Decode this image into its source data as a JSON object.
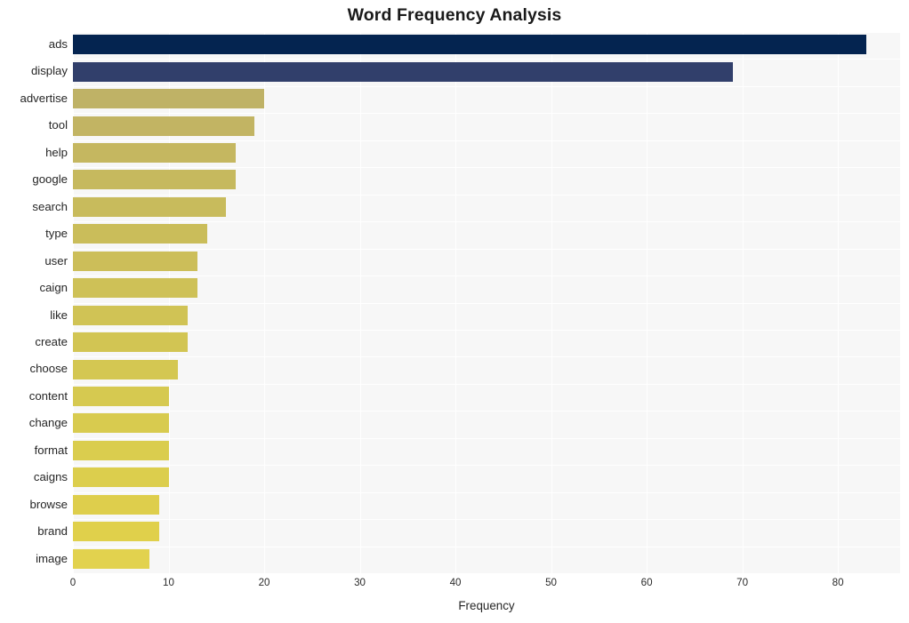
{
  "chart_data": {
    "type": "bar",
    "orientation": "horizontal",
    "title": "Word Frequency Analysis",
    "xlabel": "Frequency",
    "ylabel": "",
    "categories": [
      "ads",
      "display",
      "advertise",
      "tool",
      "help",
      "google",
      "search",
      "type",
      "user",
      "caign",
      "like",
      "create",
      "choose",
      "content",
      "change",
      "format",
      "caigns",
      "browse",
      "brand",
      "image"
    ],
    "values": [
      83,
      69,
      20,
      19,
      17,
      17,
      16,
      14,
      13,
      13,
      12,
      12,
      11,
      10,
      10,
      10,
      10,
      9,
      9,
      8
    ],
    "bar_colors": [
      "#042450",
      "#313f6b",
      "#bfb266",
      "#c2b463",
      "#c5b760",
      "#c6b95e",
      "#c8bb5c",
      "#cabd5a",
      "#ccbe59",
      "#cec157",
      "#d0c355",
      "#d2c553",
      "#d4c752",
      "#d6c950",
      "#d8cb4f",
      "#dacd4e",
      "#dcce4d",
      "#dece4c",
      "#e0d04b",
      "#e2d24e"
    ],
    "xlim": [
      0,
      86.5
    ],
    "xticks": [
      0,
      10,
      20,
      30,
      40,
      50,
      60,
      70,
      80
    ],
    "xtick_labels": [
      "0",
      "10",
      "20",
      "30",
      "40",
      "50",
      "60",
      "70",
      "80"
    ],
    "grid": true,
    "grid_color": "#ffffff",
    "plot_background": "#f7f7f7",
    "figure_background": "#ffffff",
    "legend": null,
    "title_color": "#1a1a1a"
  }
}
